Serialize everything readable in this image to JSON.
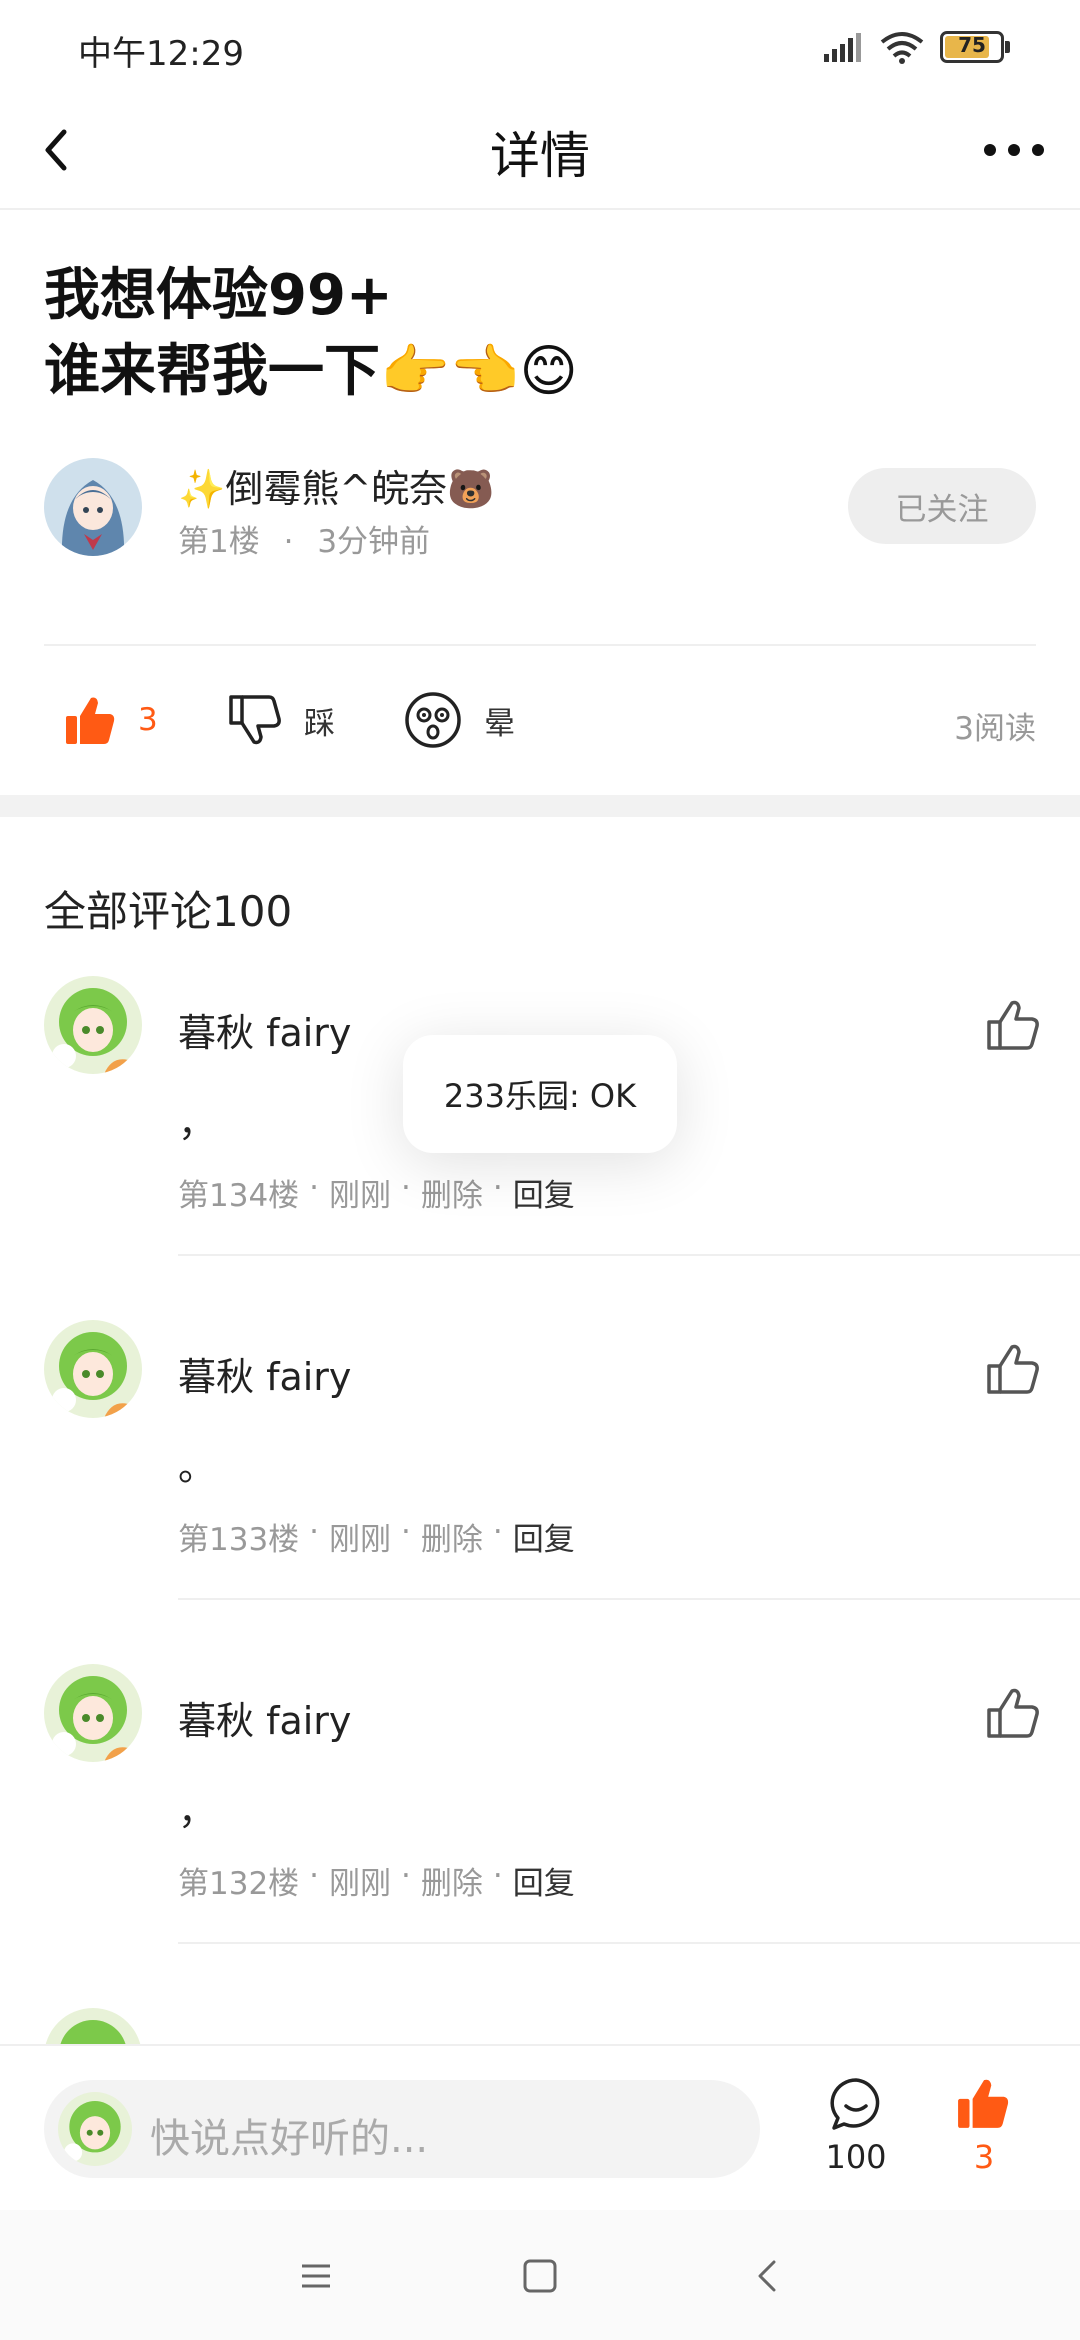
{
  "status_bar": {
    "time": "中午12:29",
    "battery": "75"
  },
  "header": {
    "title": "详情"
  },
  "post": {
    "title_line1": "我想体验99+",
    "title_line2": "谁来帮我一下👉👈😊",
    "author": "✨倒霉熊^皖奈🐻",
    "floor": "第1楼",
    "meta_dot": "·",
    "time": "3分钟前",
    "follow_label": "已关注",
    "like_count": "3",
    "dislike_label": "踩",
    "dizzy_label": "晕",
    "read_count": "3阅读"
  },
  "comments_header": "全部评论100",
  "comments": [
    {
      "name": "暮秋 fairy",
      "text": "，",
      "floor": "第134楼",
      "time": "刚刚",
      "delete": "删除",
      "reply": "回复"
    },
    {
      "name": "暮秋 fairy",
      "text": "。",
      "floor": "第133楼",
      "time": "刚刚",
      "delete": "删除",
      "reply": "回复"
    },
    {
      "name": "暮秋 fairy",
      "text": "，",
      "floor": "第132楼",
      "time": "刚刚",
      "delete": "删除",
      "reply": "回复"
    }
  ],
  "toast": "233乐园: OK",
  "bottom_bar": {
    "placeholder": "快说点好听的...",
    "comment_count": "100",
    "like_count": "3"
  },
  "colors": {
    "accent": "#ff5a14",
    "muted": "#999999"
  }
}
